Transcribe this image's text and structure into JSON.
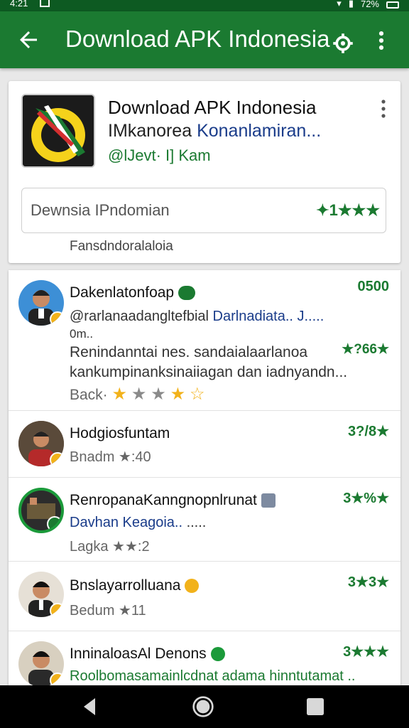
{
  "status_bar": {
    "time": "4:21",
    "battery": "72%"
  },
  "app_bar": {
    "title": "Download APK Indonesia"
  },
  "app_card": {
    "name": "Download APK Indonesia",
    "subtitle_dark": "IMkanorea ",
    "subtitle_link": "Konanlamiran...",
    "developer": "@lJevt· I] Kam",
    "search_placeholder": "Dewnsia IPndomian",
    "search_rating": "✦1★★★",
    "caption": "Fansdndoralaloia"
  },
  "reviews": [
    {
      "name": "Dakenlatonfoap",
      "score": "0500",
      "line1_dark": "@rarlanaadangltefbial ",
      "line1_link": "Darlnadiata.. J.....",
      "line2": "0m..",
      "body1": "Renindanntai nes. sandaialaarlanoa",
      "body2": "kankumpinanksinaiiagan dan iadnyandn...",
      "inline_score": "★?66★",
      "stars_label": "Back·",
      "stars": 5
    },
    {
      "name": "Hodgiosfuntam",
      "score": "3?/8★",
      "line1": "Bnadm ★:40"
    },
    {
      "name": "RenropanaKanngnopnlrunat",
      "score": "3★%★",
      "line1_link": "Davhan Keagoia..",
      "line1_tail": " .....",
      "line2": "Lagka ★★:2"
    },
    {
      "name": "Bnslayarrolluana",
      "score": "3★3★",
      "line1": "Bedum ★11"
    },
    {
      "name": "InninaloasAl Denons",
      "score": "3★★★",
      "line1": "Roolbomasamainlcdnat adama hinntutamat .."
    }
  ],
  "colors": {
    "primary": "#1b7a31",
    "status": "#0d5a22",
    "accent_star": "#f2b21b",
    "link": "#1a3c8a"
  }
}
